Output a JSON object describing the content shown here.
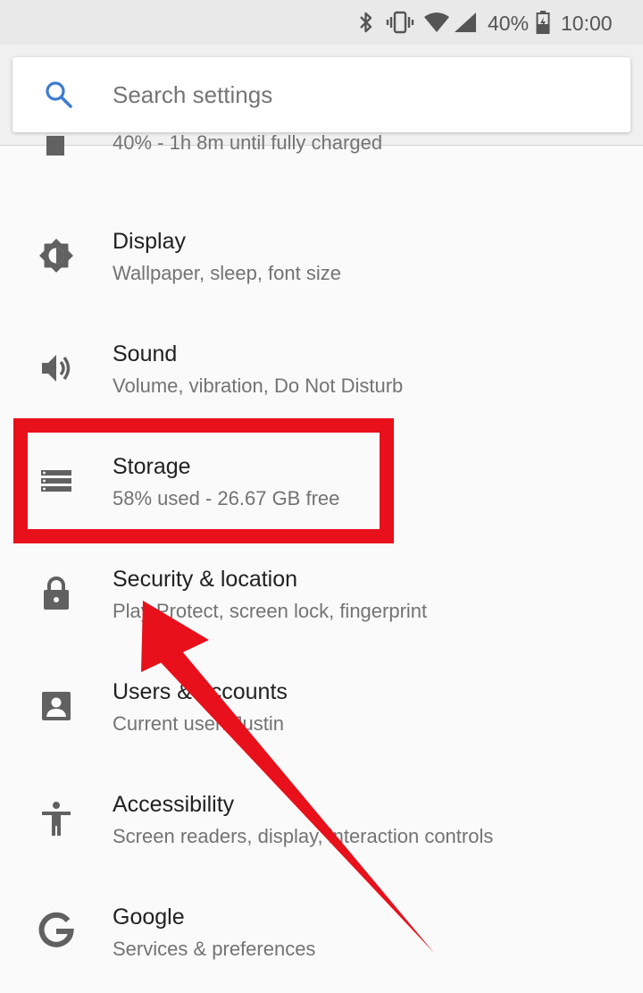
{
  "status_bar": {
    "battery_percent": "40%",
    "time": "10:00",
    "icons": [
      "bluetooth-icon",
      "vibrate-icon",
      "wifi-icon",
      "cell-signal-icon",
      "battery-charging-icon"
    ]
  },
  "search": {
    "placeholder": "Search settings",
    "icon": "search-icon"
  },
  "settings": {
    "items": [
      {
        "title": "",
        "subtitle": "40% - 1h 8m until fully charged",
        "icon": "battery-icon"
      },
      {
        "title": "Display",
        "subtitle": "Wallpaper, sleep, font size",
        "icon": "brightness-icon"
      },
      {
        "title": "Sound",
        "subtitle": "Volume, vibration, Do Not Disturb",
        "icon": "volume-icon"
      },
      {
        "title": "Storage",
        "subtitle": "58% used - 26.67 GB free",
        "icon": "storage-icon"
      },
      {
        "title": "Security & location",
        "subtitle": "Play Protect, screen lock, fingerprint",
        "icon": "lock-icon"
      },
      {
        "title": "Users & accounts",
        "subtitle": "Current user: Justin",
        "icon": "account-box-icon"
      },
      {
        "title": "Accessibility",
        "subtitle": "Screen readers, display, interaction controls",
        "icon": "accessibility-icon"
      },
      {
        "title": "Google",
        "subtitle": "Services & preferences",
        "icon": "google-icon"
      }
    ]
  },
  "annotation": {
    "highlight_color": "#e8101b",
    "highlighted_item": "Storage"
  }
}
